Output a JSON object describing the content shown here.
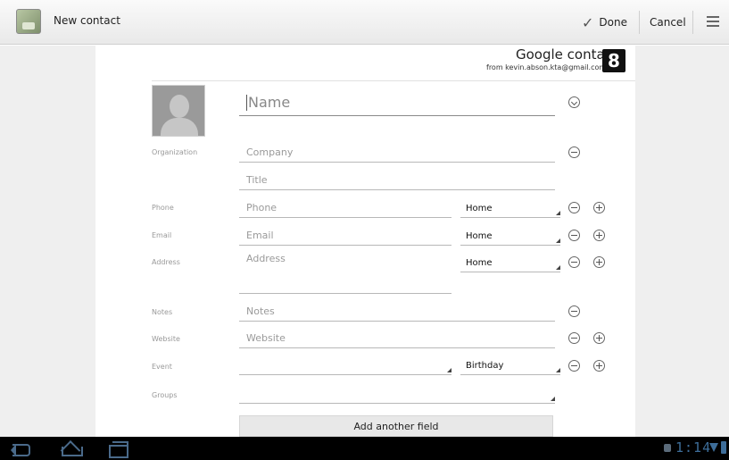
{
  "actionbar": {
    "title": "New contact",
    "done_label": "Done",
    "cancel_label": "Cancel"
  },
  "account": {
    "title": "Google contact",
    "from": "from kevin.abson.kta@gmail.com",
    "logo_letter": "8"
  },
  "form": {
    "name_placeholder": "Name",
    "organization_label": "Organization",
    "company_placeholder": "Company",
    "title_placeholder": "Title",
    "phone_label": "Phone",
    "phone_placeholder": "Phone",
    "phone_type": "Home",
    "email_label": "Email",
    "email_placeholder": "Email",
    "email_type": "Home",
    "address_label": "Address",
    "address_placeholder": "Address",
    "address_type": "Home",
    "notes_label": "Notes",
    "notes_placeholder": "Notes",
    "website_label": "Website",
    "website_placeholder": "Website",
    "event_label": "Event",
    "event_type": "Birthday",
    "groups_label": "Groups",
    "add_field_label": "Add another field"
  },
  "statusbar": {
    "clock": "1:14"
  },
  "icons": {
    "back": "back-icon",
    "home": "home-icon",
    "recent": "recent-apps-icon",
    "menu": "overflow-menu-icon",
    "check": "checkmark-icon"
  },
  "colors": {
    "status_accent": "#3d6d99",
    "side_panel": "#efefef"
  }
}
